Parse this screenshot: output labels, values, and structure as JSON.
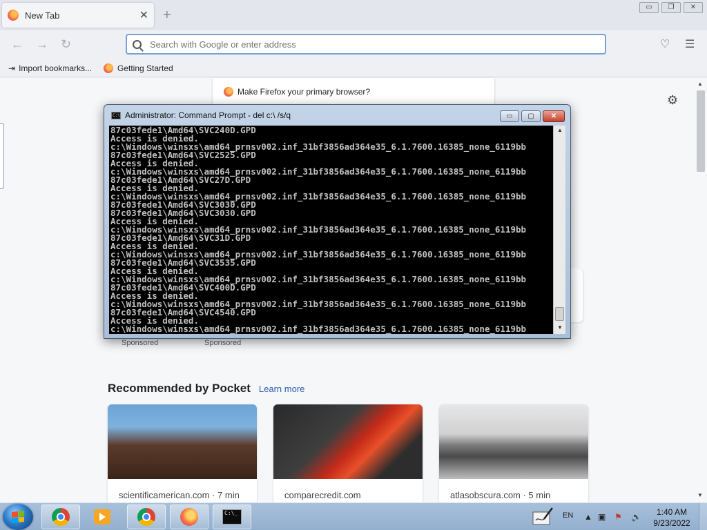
{
  "firefox": {
    "tab": {
      "title": "New Tab",
      "close": "✕"
    },
    "new_tab_symbol": "+",
    "window_controls": {
      "minimize": "▭",
      "restore": "❐",
      "close": "✕"
    },
    "urlbar": {
      "placeholder": "Search with Google or enter address"
    },
    "bookmarks": [
      {
        "label": "Import bookmarks...",
        "icon": "import-icon"
      },
      {
        "label": "Getting Started",
        "icon": "firefox-icon"
      }
    ],
    "default_browser_prompt": "Make Firefox your primary browser?",
    "sponsored_labels": [
      "Sponsored",
      "Sponsored"
    ],
    "pocket": {
      "heading": "Recommended by Pocket",
      "learn_more": "Learn more",
      "cards": [
        {
          "source": "scientificamerican.com · 7 min"
        },
        {
          "source": "comparecredit.com"
        },
        {
          "source": "atlasobscura.com · 5 min"
        }
      ]
    }
  },
  "cmd": {
    "title": "Administrator: Command Prompt - del  c:\\ /s/q",
    "buttons": {
      "minimize": "▭",
      "maximize": "▢",
      "close": "✕"
    },
    "lines": [
      "87c03fede1\\Amd64\\SVC240D.GPD",
      "Access is denied.",
      "c:\\Windows\\winsxs\\amd64_prnsv002.inf_31bf3856ad364e35_6.1.7600.16385_none_6119bb",
      "87c03fede1\\Amd64\\SVC2525.GPD",
      "Access is denied.",
      "c:\\Windows\\winsxs\\amd64_prnsv002.inf_31bf3856ad364e35_6.1.7600.16385_none_6119bb",
      "87c03fede1\\Amd64\\SVC27D.GPD",
      "Access is denied.",
      "c:\\Windows\\winsxs\\amd64_prnsv002.inf_31bf3856ad364e35_6.1.7600.16385_none_6119bb",
      "87c03fede1\\Amd64\\SVC3030.GPD",
      "87c03fede1\\Amd64\\SVC3030.GPD",
      "Access is denied.",
      "c:\\Windows\\winsxs\\amd64_prnsv002.inf_31bf3856ad364e35_6.1.7600.16385_none_6119bb",
      "87c03fede1\\Amd64\\SVC31D.GPD",
      "Access is denied.",
      "c:\\Windows\\winsxs\\amd64_prnsv002.inf_31bf3856ad364e35_6.1.7600.16385_none_6119bb",
      "87c03fede1\\Amd64\\SVC3535.GPD",
      "Access is denied.",
      "c:\\Windows\\winsxs\\amd64_prnsv002.inf_31bf3856ad364e35_6.1.7600.16385_none_6119bb",
      "87c03fede1\\Amd64\\SVC400D.GPD",
      "Access is denied.",
      "c:\\Windows\\winsxs\\amd64_prnsv002.inf_31bf3856ad364e35_6.1.7600.16385_none_6119bb",
      "87c03fede1\\Amd64\\SVC4540.GPD",
      "Access is denied.",
      "c:\\Windows\\winsxs\\amd64_prnsv002.inf_31bf3856ad364e35_6.1.7600.16385_none_6119bb"
    ]
  },
  "taskbar": {
    "language": "EN",
    "time": "1:40 AM",
    "date": "9/23/2022"
  }
}
